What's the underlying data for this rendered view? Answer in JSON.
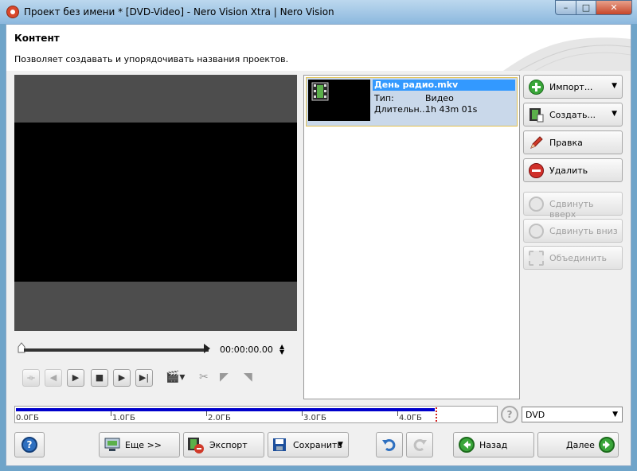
{
  "window": {
    "title": "Проект без имени * [DVD-Video] - Nero Vision Xtra | Nero Vision",
    "min_label": "–",
    "max_label": "□",
    "close_label": "✕"
  },
  "header": {
    "title": "Контент",
    "description": "Позволяет создавать и упорядочивать названия проектов."
  },
  "player": {
    "timecode": "00:00:00.00"
  },
  "project_list": {
    "items": [
      {
        "name": "День радио.mkv",
        "type_label": "Тип:",
        "type_value": "Видео",
        "duration_label": "Длительн...",
        "duration_value": "1h 43m 01s"
      }
    ]
  },
  "side_buttons": {
    "import": "Импорт...",
    "create": "Создать...",
    "edit": "Правка",
    "delete": "Удалить",
    "move_up": "Сдвинуть вверх",
    "move_down": "Сдвинуть вниз",
    "merge": "Объединить"
  },
  "capacity": {
    "ticks": [
      "0.0ГБ",
      "1.0ГБ",
      "2.0ГБ",
      "3.0ГБ",
      "4.0ГБ"
    ],
    "used_fraction": 0.87
  },
  "disc": {
    "selected": "DVD"
  },
  "bottom": {
    "more": "Еще >>",
    "export": "Экспорт",
    "save": "Сохранить",
    "back": "Назад",
    "next": "Далее"
  }
}
